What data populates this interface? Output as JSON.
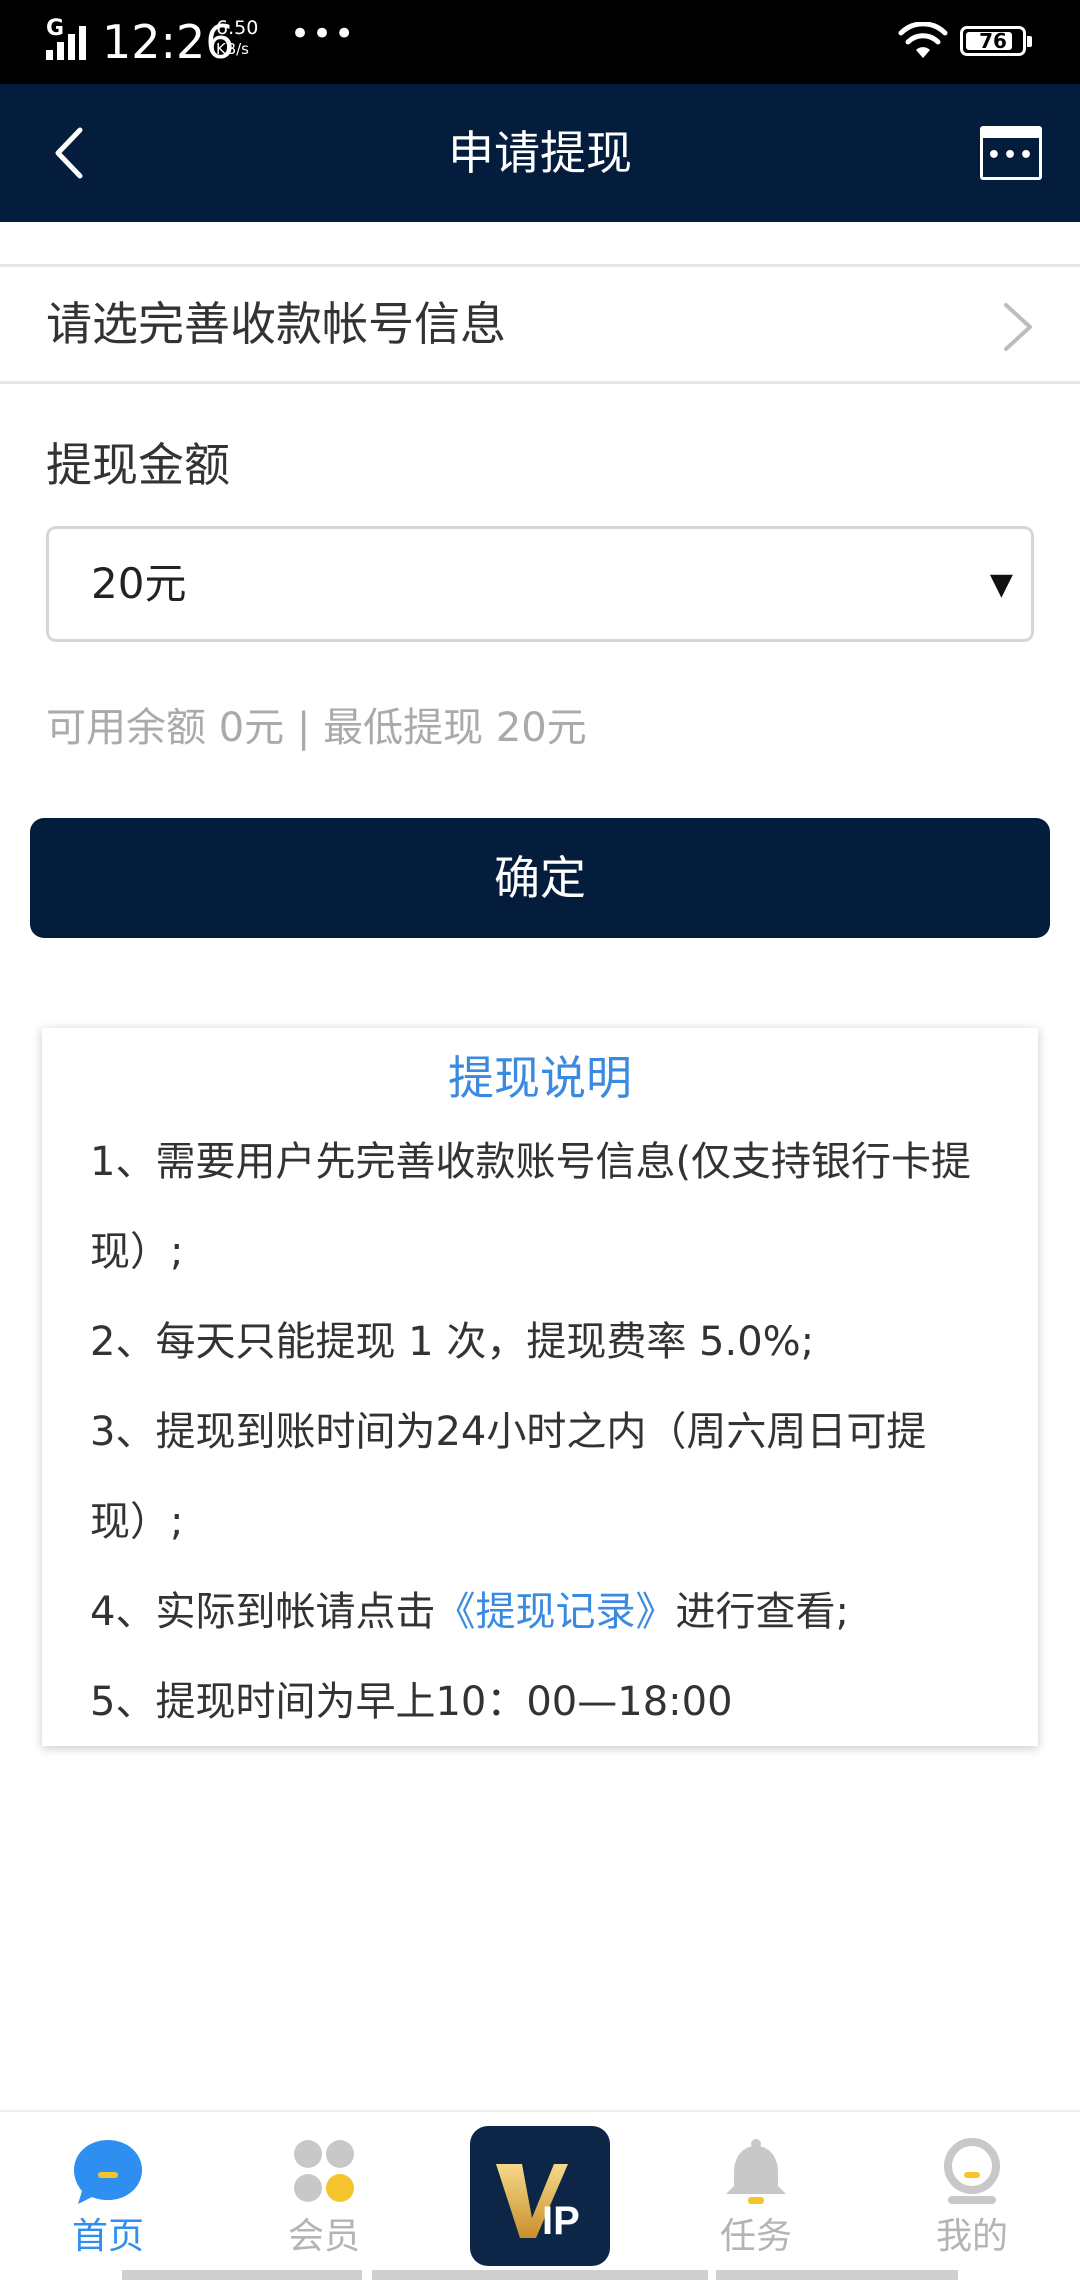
{
  "status_bar": {
    "network": "G",
    "time": "12:26",
    "speed_value": "6.50",
    "speed_unit": "KB/s",
    "more": "•••",
    "battery": "76"
  },
  "header": {
    "title": "申请提现",
    "back_icon": "chevron-left-icon",
    "menu_icon": "keyboard-icon"
  },
  "account": {
    "label": "请选完善收款帐号信息",
    "chevron_icon": "chevron-right-icon"
  },
  "amount": {
    "label": "提现金额",
    "selected": "20元",
    "arrow": "▼"
  },
  "balance_info": "可用余额 0元 | 最低提现 20元",
  "confirm_label": "确定",
  "instructions": {
    "title": "提现说明",
    "lines": [
      "1、需要用户先完善收款账号信息(仅支持银行卡提",
      "现）;",
      "2、每天只能提现 1 次，提现费率 5.0%;",
      "3、提现到账时间为24小时之内（周六周日可提",
      "现）;",
      "4、实际到帐请点击",
      "《提现记录》",
      "进行查看;",
      "5、提现时间为早上10：00—18:00"
    ]
  },
  "tabbar": {
    "tabs": [
      {
        "label": "首页",
        "icon": "chat-bubble-icon",
        "active": true
      },
      {
        "label": "会员",
        "icon": "members-icon",
        "active": false
      },
      {
        "label": "VIP",
        "icon": "vip-badge-icon",
        "active": false
      },
      {
        "label": "任务",
        "icon": "bell-icon",
        "active": false
      },
      {
        "label": "我的",
        "icon": "profile-icon",
        "active": false
      }
    ]
  },
  "colors": {
    "navy": "#051d3d",
    "accent_blue": "#3a8be0",
    "tab_active": "#2e8ff0",
    "muted_text": "#aaaaaa",
    "vip_gold": "#e7b54a"
  }
}
